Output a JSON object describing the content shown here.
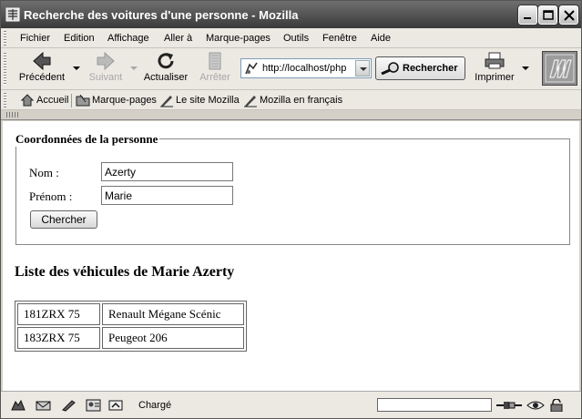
{
  "window": {
    "title": "Recherche des voitures d'une personne - Mozilla"
  },
  "menu": [
    "Fichier",
    "Edition",
    "Affichage",
    "Aller à",
    "Marque-pages",
    "Outils",
    "Fenêtre",
    "Aide"
  ],
  "toolbar": {
    "back_label": "Précédent",
    "forward_label": "Suivant",
    "reload_label": "Actualiser",
    "stop_label": "Arrêter",
    "url": "http://localhost/php",
    "search_label": "Rechercher",
    "print_label": "Imprimer"
  },
  "bookmarks": [
    "Accueil",
    "Marque-pages",
    "Le site Mozilla",
    "Mozilla en français"
  ],
  "form": {
    "legend": "Coordonnées de la personne",
    "nom_label": "Nom :",
    "nom_value": "Azerty",
    "prenom_label": "Prénom :",
    "prenom_value": "Marie",
    "submit_label": "Chercher"
  },
  "results": {
    "heading": "Liste des véhicules de Marie Azerty",
    "rows": [
      {
        "plate": "181ZRX 75",
        "model": "Renault Mégane Scénic"
      },
      {
        "plate": "183ZRX 75",
        "model": "Peugeot 206"
      }
    ]
  },
  "status": {
    "text": "Chargé"
  },
  "icons": {
    "app": "mozilla-app-icon",
    "back": "back-arrow-icon",
    "forward": "forward-arrow-icon",
    "reload": "reload-icon",
    "stop": "stop-icon",
    "search": "search-magnifier-icon",
    "print": "printer-icon",
    "throbber": "mozilla-m-logo"
  }
}
